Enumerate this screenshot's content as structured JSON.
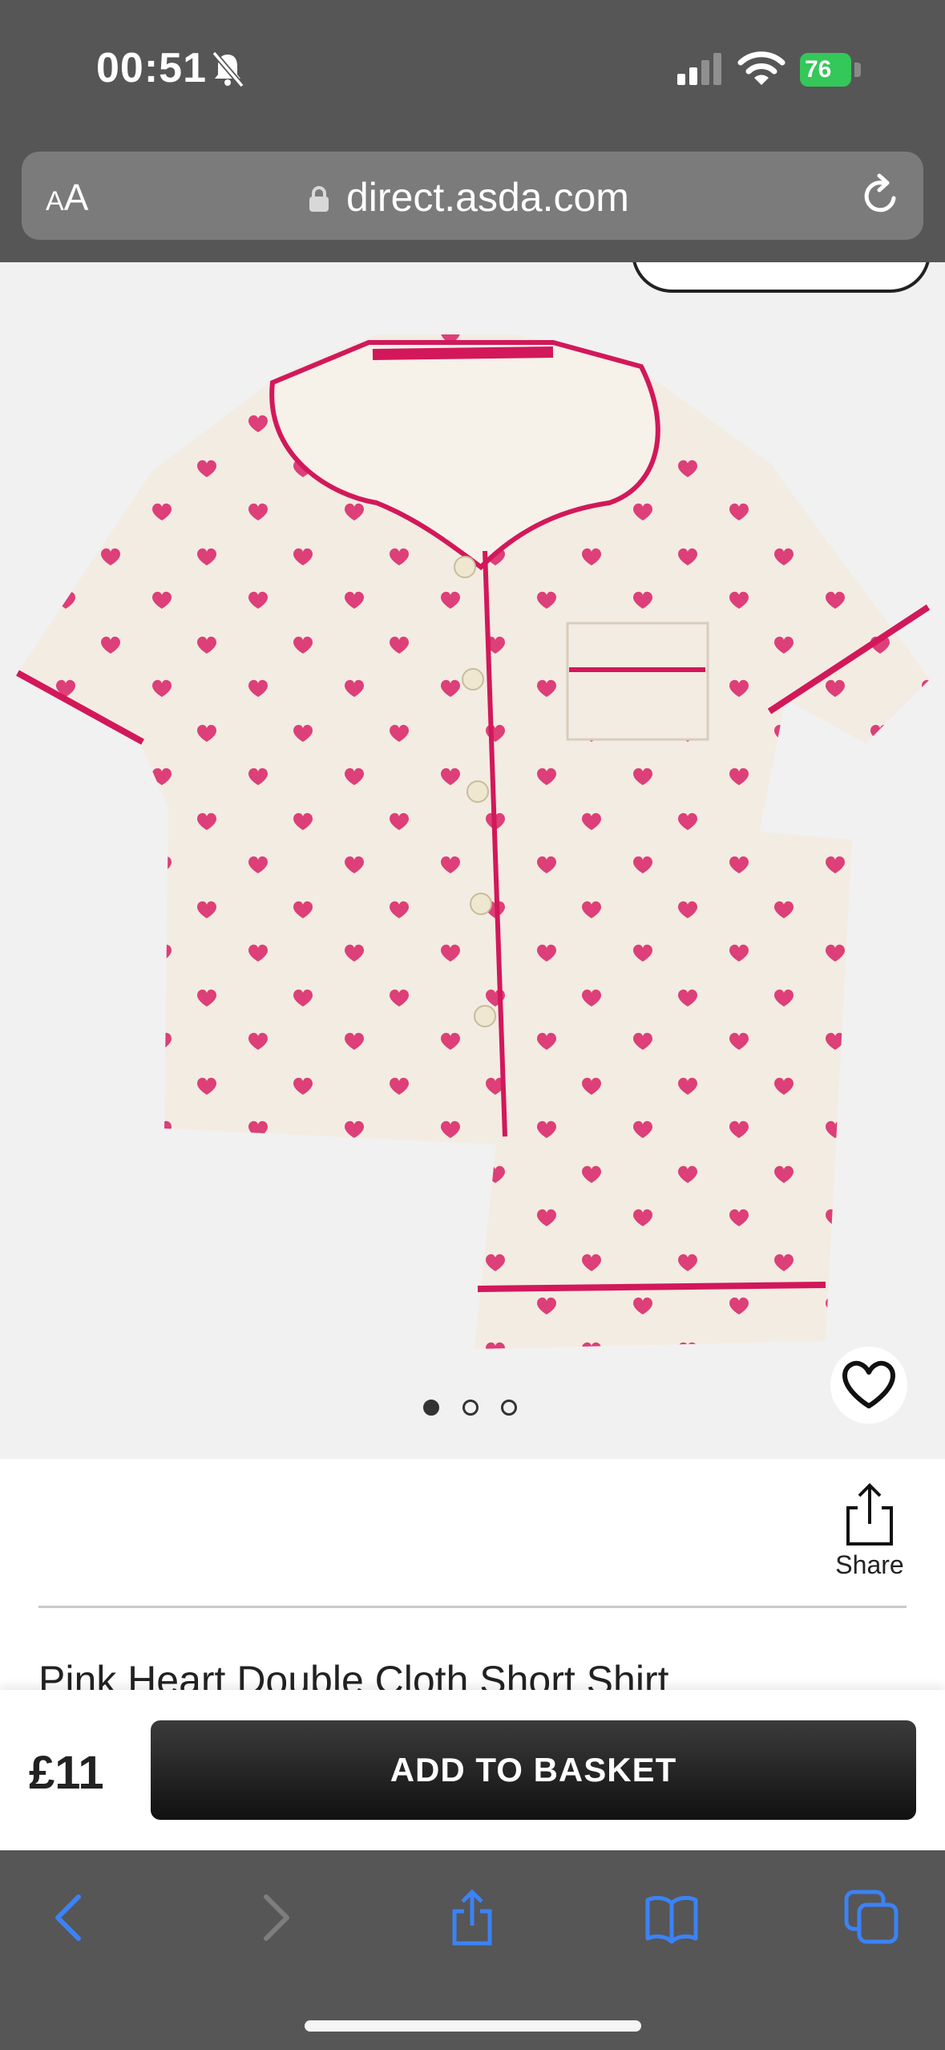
{
  "status_bar": {
    "time": "00:51",
    "battery_percent": "76",
    "icons": [
      "bell-muted-icon",
      "cellular-signal-icon",
      "wifi-icon",
      "battery-charging-icon"
    ]
  },
  "browser": {
    "text_size_label_small": "A",
    "text_size_label_large": "A",
    "url": "direct.asda.com",
    "icons": [
      "lock-icon",
      "reload-icon"
    ]
  },
  "gallery": {
    "image_count": 3,
    "active_index": 0,
    "icons": [
      "heart-icon"
    ]
  },
  "product": {
    "share_label": "Share",
    "title": "Pink Heart Double Cloth Short Shirt"
  },
  "buy_bar": {
    "price": "£11",
    "add_label": "ADD TO BASKET"
  },
  "toolbar": {
    "icons": [
      "back-icon",
      "forward-icon",
      "share-icon",
      "bookmarks-icon",
      "tabs-icon"
    ]
  },
  "colors": {
    "chrome": "#565656",
    "accent_blue": "#3b82f6",
    "pajama_base": "#f3ece2",
    "heart_pink": "#dd3f78",
    "piping": "#d2185a"
  }
}
